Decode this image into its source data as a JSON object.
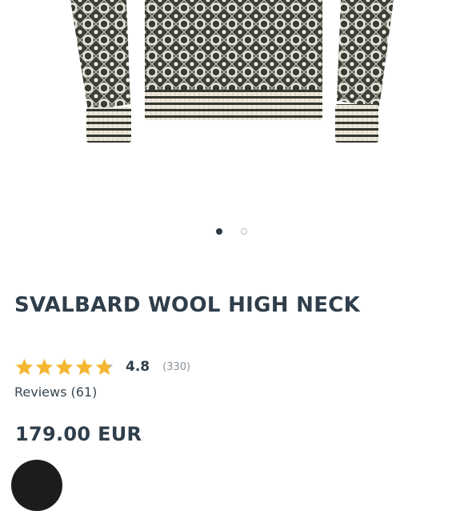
{
  "gallery": {
    "image_alt": "Svalbard wool high neck sweater",
    "slide_count": 2,
    "active_slide": 1
  },
  "product": {
    "title": "SVALBARD WOOL HIGH NECK",
    "rating": {
      "value": "4.8",
      "count": "(330)",
      "stars_filled": 4.8,
      "stars_total": 5
    },
    "reviews_label": "Reviews (61)",
    "price": "179.00 EUR"
  },
  "colors": {
    "text": "#2f3e4a",
    "star": "#f5b731",
    "star_empty": "#b5b5b5",
    "knit_dark": "#3a3d36",
    "knit_light": "#ece8db"
  },
  "icons": {
    "star": "star-icon",
    "chat": "chat-icon"
  }
}
